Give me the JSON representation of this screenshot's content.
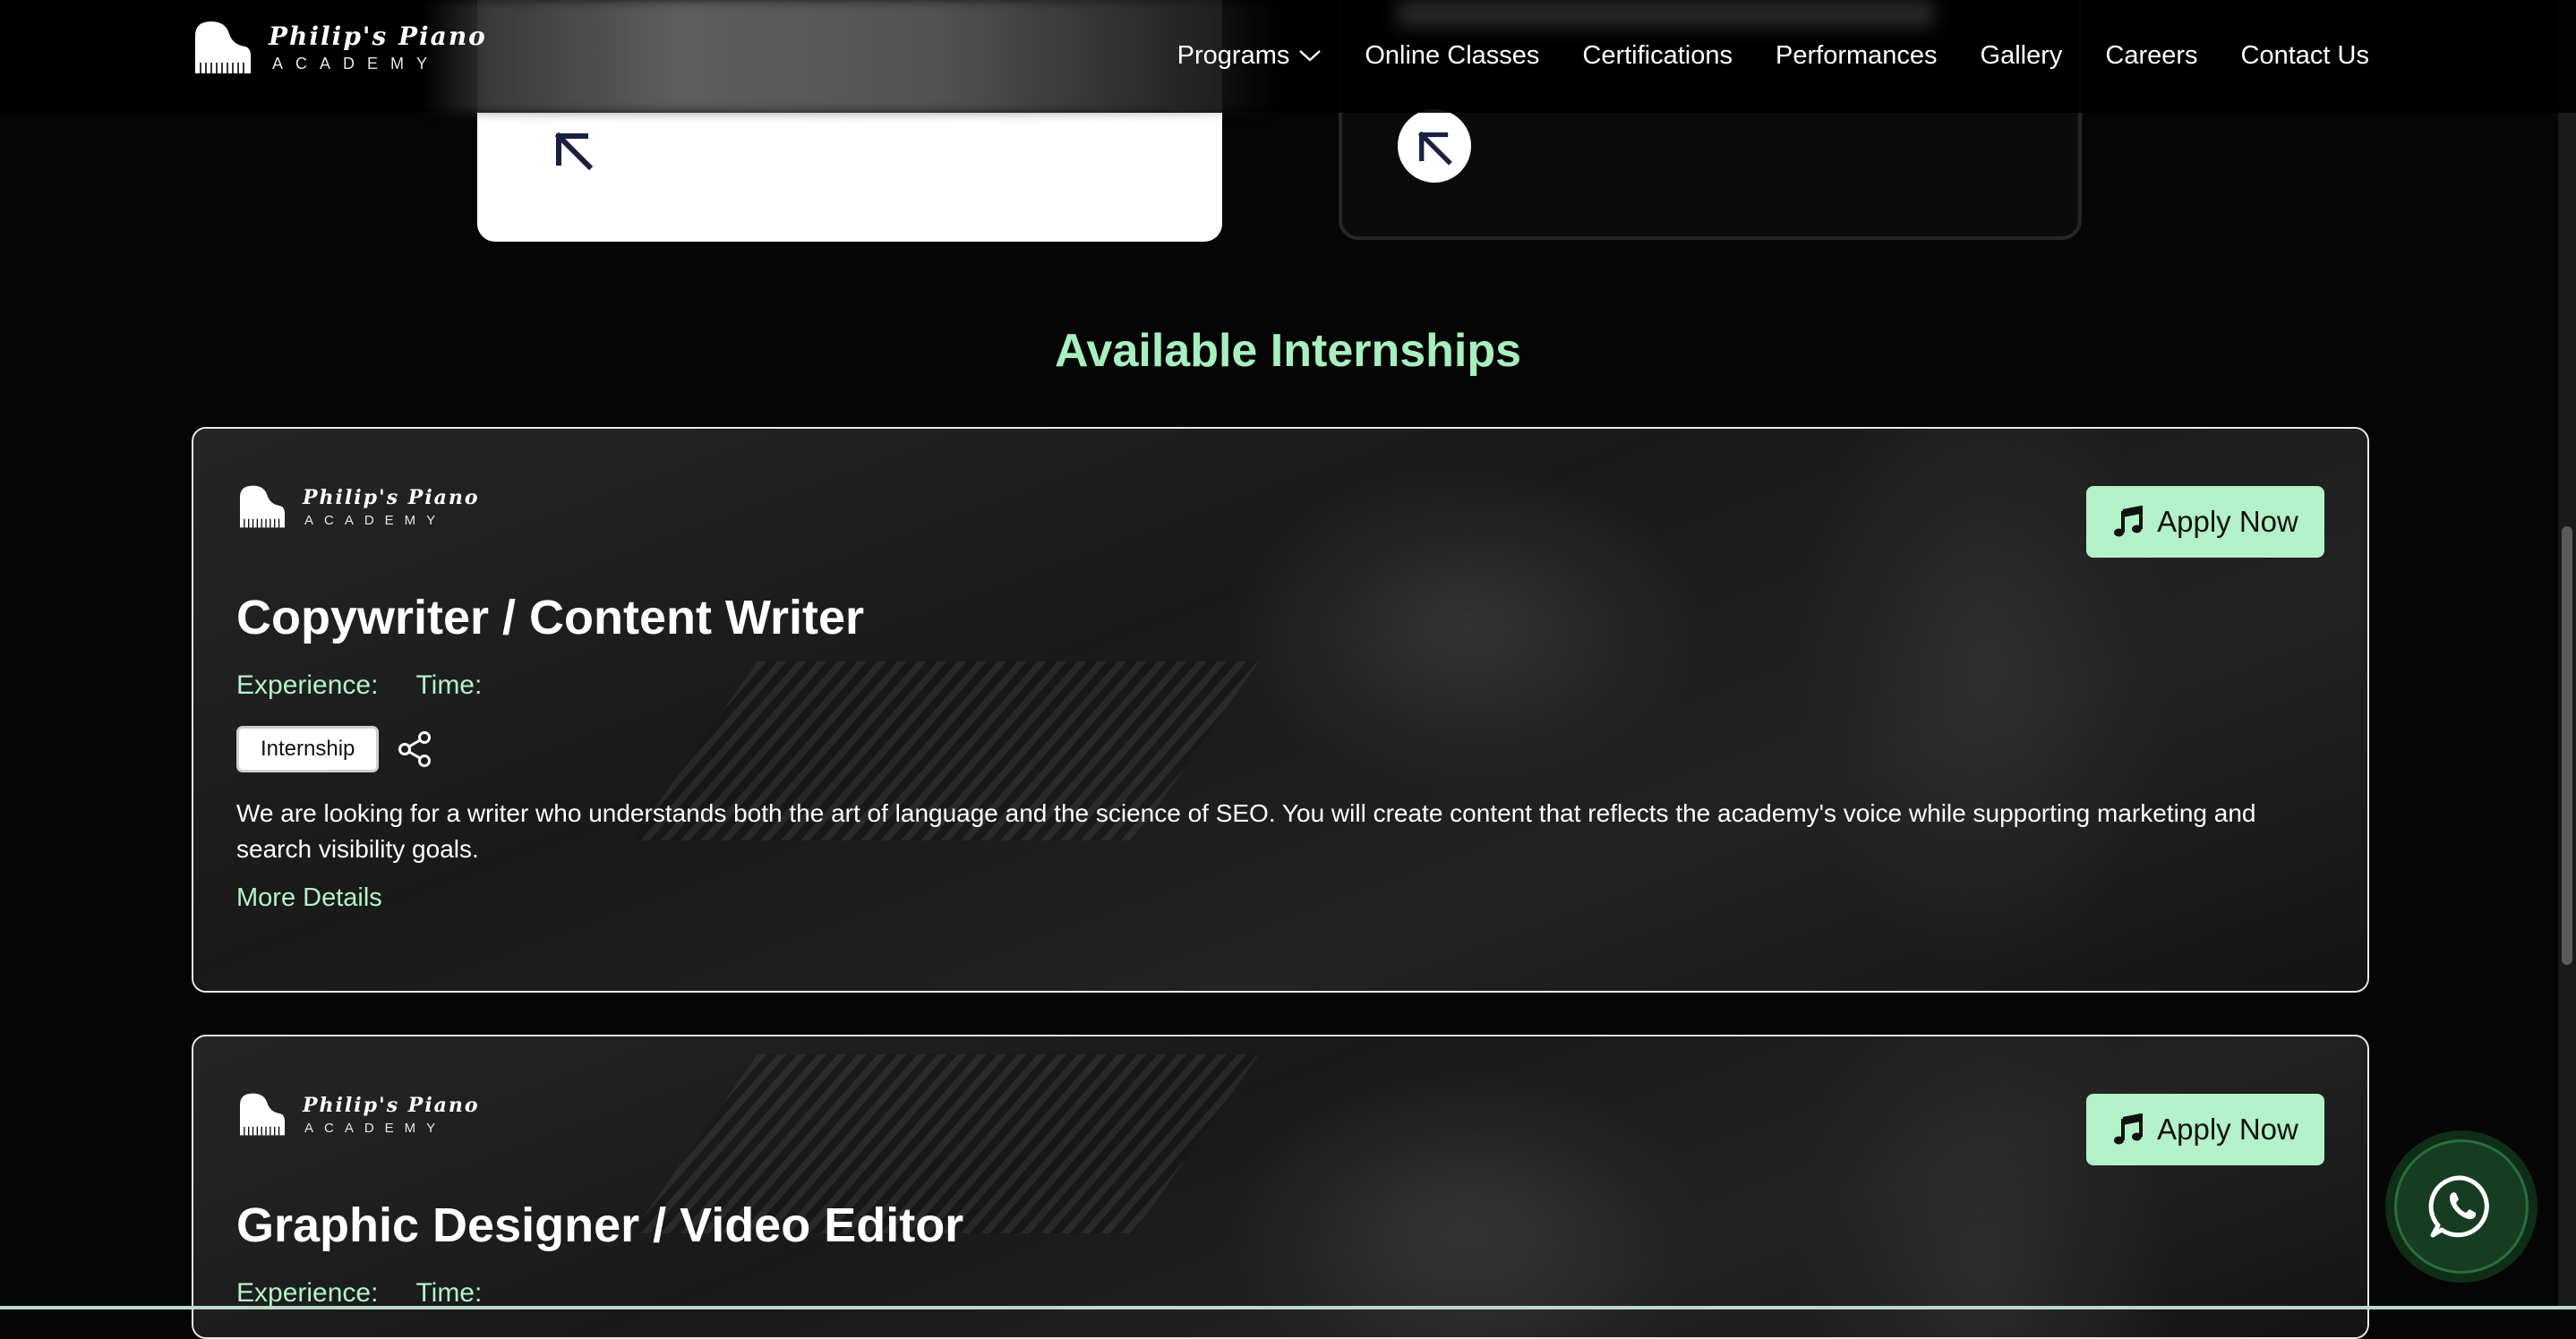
{
  "brand": {
    "name": "Philip's Piano",
    "sub": "ACADEMY"
  },
  "nav": {
    "items": [
      {
        "label": "Programs",
        "has_dropdown": true
      },
      {
        "label": "Online Classes"
      },
      {
        "label": "Certifications"
      },
      {
        "label": "Performances"
      },
      {
        "label": "Gallery"
      },
      {
        "label": "Careers"
      },
      {
        "label": "Contact Us"
      }
    ]
  },
  "section": {
    "title": "Available Internships"
  },
  "jobs": [
    {
      "title": "Copywriter / Content Writer",
      "experience_label": "Experience:",
      "time_label": "Time:",
      "tag": "Internship",
      "description": "We are looking for a writer who understands both the art of language and the science of SEO. You will create content that reflects the academy's voice while supporting marketing and search visibility goals.",
      "more_label": "More Details",
      "apply_label": "Apply Now"
    },
    {
      "title": "Graphic Designer / Video Editor",
      "experience_label": "Experience:",
      "time_label": "Time:",
      "apply_label": "Apply Now"
    }
  ],
  "icons": {
    "arrow": "arrow-up-left-icon",
    "music": "music-note-icon",
    "share": "share-icon",
    "whatsapp": "whatsapp-icon",
    "chevron": "chevron-down-icon"
  },
  "colors": {
    "accent": "#a8efc0",
    "button_bg": "#b3f2c8",
    "background": "#050505"
  }
}
